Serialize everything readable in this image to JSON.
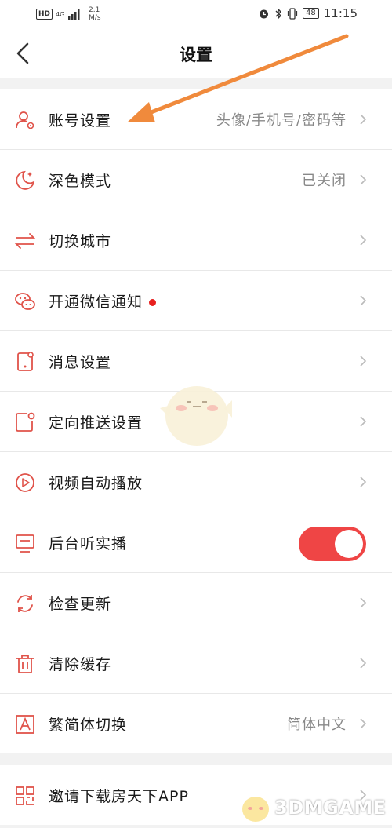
{
  "status_bar": {
    "hd": "HD",
    "network": "4G",
    "speed_value": "2.1",
    "speed_unit": "M/s",
    "battery": "48",
    "time": "11:15"
  },
  "nav": {
    "title": "设置"
  },
  "settings": {
    "account": {
      "label": "账号设置",
      "value": "头像/手机号/密码等",
      "icon": "user-gear-icon"
    },
    "dark_mode": {
      "label": "深色模式",
      "value": "已关闭",
      "icon": "moon-icon"
    },
    "switch_city": {
      "label": "切换城市",
      "icon": "swap-arrows-icon"
    },
    "wechat_notify": {
      "label": "开通微信通知",
      "icon": "wechat-icon",
      "has_red_dot": true
    },
    "message_settings": {
      "label": "消息设置",
      "icon": "phone-notification-icon"
    },
    "push_settings": {
      "label": "定向推送设置",
      "icon": "targeted-push-icon"
    },
    "autoplay_video": {
      "label": "视频自动播放",
      "icon": "play-icon"
    },
    "background_listen": {
      "label": "后台听实播",
      "icon": "monitor-icon",
      "toggle_on": true
    },
    "check_update": {
      "label": "检查更新",
      "icon": "refresh-icon"
    },
    "clear_cache": {
      "label": "清除缓存",
      "icon": "trash-icon"
    },
    "traditional_simplified": {
      "label": "繁简体切换",
      "value": "简体中文",
      "icon": "letter-a-icon"
    },
    "invite_download": {
      "label": "邀请下载房天下APP",
      "icon": "qr-code-icon"
    }
  },
  "colors": {
    "accent_red": "#ef4545",
    "icon_red": "#e0534a",
    "arrow_orange": "#f08a3c"
  },
  "watermark": {
    "text": "3DMGAME"
  }
}
